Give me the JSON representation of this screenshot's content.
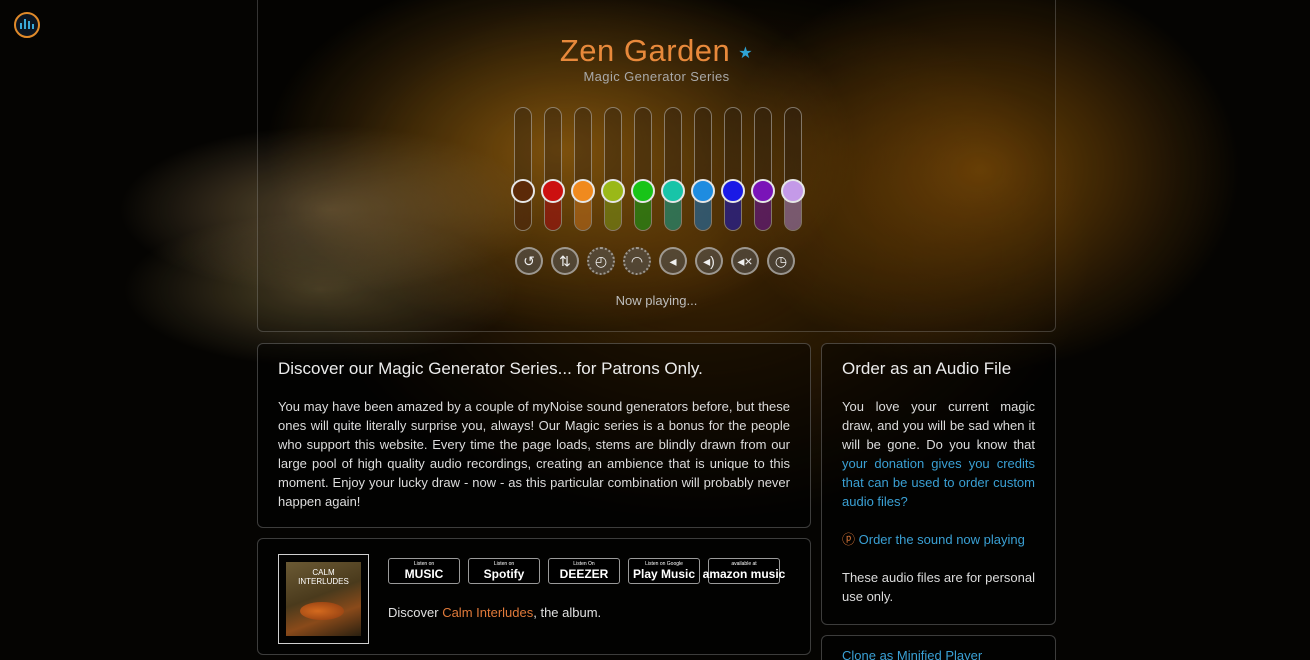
{
  "header": {
    "logo_icon": "equalizer-logo-icon",
    "title": "Zen Garden",
    "title_color": "#e8893b",
    "star_icon": "★",
    "subtitle": "Magic Generator Series",
    "now_playing": "Now playing..."
  },
  "sliders": [
    {
      "name": "slider-1",
      "color": "#5c2a08",
      "level": 0.32
    },
    {
      "name": "slider-2",
      "color": "#cc1010",
      "level": 0.32
    },
    {
      "name": "slider-3",
      "color": "#f08a1e",
      "level": 0.32
    },
    {
      "name": "slider-4",
      "color": "#9ab818",
      "level": 0.32
    },
    {
      "name": "slider-5",
      "color": "#18c418",
      "level": 0.32
    },
    {
      "name": "slider-6",
      "color": "#18c4a8",
      "level": 0.32
    },
    {
      "name": "slider-7",
      "color": "#1e8ce0",
      "level": 0.32
    },
    {
      "name": "slider-8",
      "color": "#1a1ae6",
      "level": 0.32
    },
    {
      "name": "slider-9",
      "color": "#7a14b8",
      "level": 0.32
    },
    {
      "name": "slider-10",
      "color": "#c49ae8",
      "level": 0.32
    }
  ],
  "controls": [
    {
      "name": "reset-icon",
      "glyph": "↺"
    },
    {
      "name": "animate-sliders-icon",
      "glyph": "⇅"
    },
    {
      "name": "timer-icon",
      "glyph": "◴"
    },
    {
      "name": "speed-icon",
      "glyph": "◠"
    },
    {
      "name": "volume-down-icon",
      "glyph": "◂"
    },
    {
      "name": "volume-up-icon",
      "glyph": "◂)"
    },
    {
      "name": "mute-icon",
      "glyph": "◂×"
    },
    {
      "name": "clock-icon",
      "glyph": "◷"
    }
  ],
  "discover": {
    "title": "Discover our Magic Generator Series... for Patrons Only.",
    "body": "You may have been amazed by a couple of myNoise sound generators before, but these ones will quite literally surprise you, always! Our Magic series is a bonus for the people who support this website. Every time the page loads, stems are blindly drawn from our large pool of high quality audio recordings, creating an ambience that is unique to this moment. Enjoy your lucky draw - now - as this particular combination will probably never happen again!"
  },
  "album": {
    "cover_line1": "CALM",
    "cover_line2": "INTERLUDES",
    "badges": [
      {
        "name": "apple-music-badge",
        "small": "Listen on",
        "label": " MUSIC"
      },
      {
        "name": "spotify-badge",
        "small": "Listen on",
        "label": "Spotify"
      },
      {
        "name": "deezer-badge",
        "small": "Listen On",
        "label": "DEEZER"
      },
      {
        "name": "google-play-badge",
        "small": "Listen on Google",
        "label": "Play Music"
      },
      {
        "name": "amazon-music-badge",
        "small": "available at",
        "label": "amazon music"
      }
    ],
    "text_before": "Discover ",
    "link": "Calm Interludes",
    "text_after": ", the album."
  },
  "order": {
    "title": "Order as an Audio File",
    "text_before": "You love your current magic draw, and you will be sad when it will be gone. Do you know that ",
    "link": "your donation gives you credits that can be used to order custom audio files?",
    "order_icon": "ⓟ",
    "order_link": "Order the sound now playing",
    "note": "These audio files are for personal use only."
  },
  "clone": {
    "link": "Clone as Minified Player"
  }
}
